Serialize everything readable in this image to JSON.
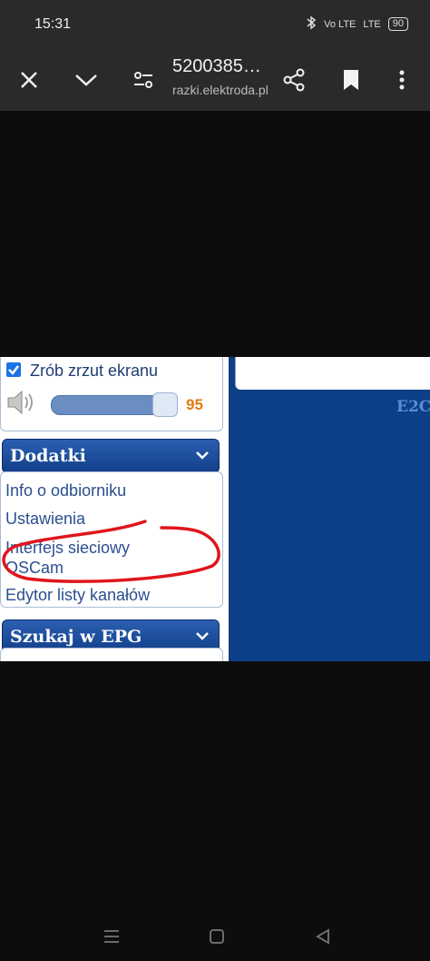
{
  "status_bar": {
    "time": "15:31",
    "network_label_1": "Vo LTE",
    "network_label_2": "LTE",
    "battery": "90"
  },
  "toolbar": {
    "title": "5200385…",
    "url": "razki.elektroda.pl"
  },
  "embedded": {
    "screenshot_checkbox_label": "Zrób zrzut ekranu",
    "volume_value": "95",
    "volume_level": 0.95,
    "dodatki_header": "Dodatki",
    "menu_items": [
      "Info o odbiorniku",
      "Ustawienia",
      "Interfejs sieciowy",
      "OSCam",
      "Edytor listy kanałów"
    ],
    "epg_header": "Szukaj w EPG",
    "main_text": "E2C"
  },
  "colors": {
    "header_blue": "#123f8a",
    "main_blue": "#0c3f86",
    "link_blue": "#2a4f8f",
    "volume_orange": "#e07a10",
    "annotation_red": "#e0151c"
  }
}
